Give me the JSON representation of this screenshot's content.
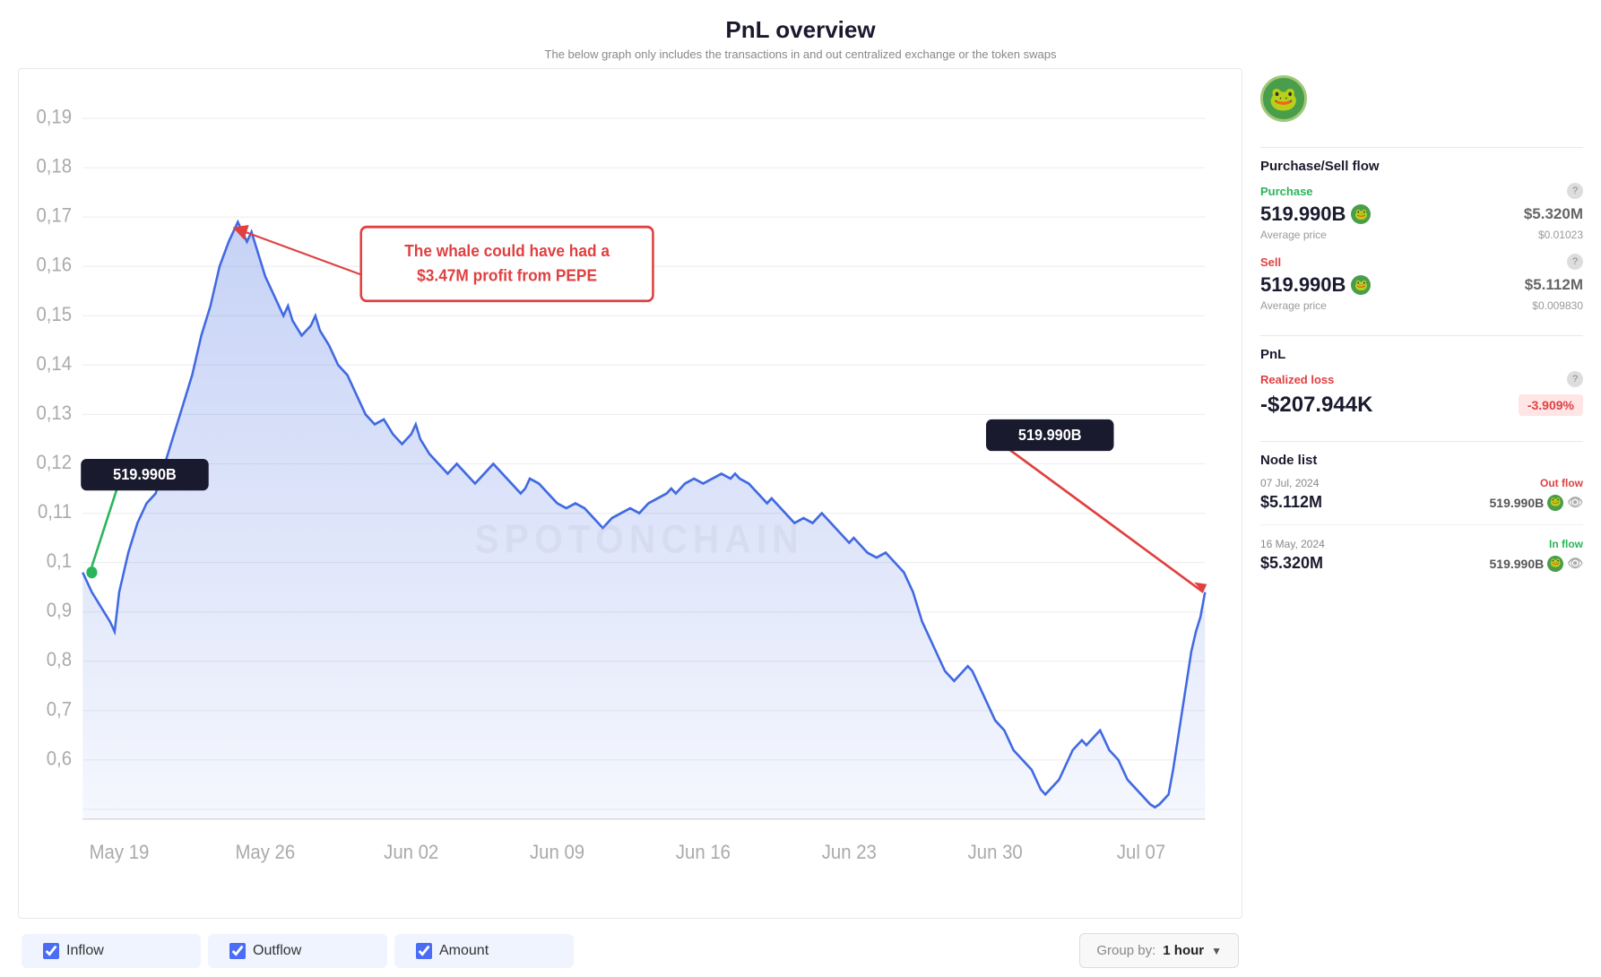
{
  "header": {
    "title": "PnL overview",
    "subtitle": "The below graph only includes the transactions in and out centralized exchange or the token swaps"
  },
  "chart": {
    "watermark": "SPOTONCHAIN",
    "annotation_text": "The whale could have had a\n$3.47M profit from PEPE",
    "tooltip_left": "519.990B",
    "tooltip_right": "519.990B",
    "y_axis_labels": [
      "0,19",
      "0,18",
      "0,17",
      "0,16",
      "0,15",
      "0,14",
      "0,13",
      "0,12",
      "0,11",
      "0,1",
      "0,9",
      "0,8",
      "0,7",
      "0,6"
    ],
    "x_axis_labels": [
      "May 19",
      "May 26",
      "Jun 02",
      "Jun 09",
      "Jun 16",
      "Jun 23",
      "Jun 30",
      "Jul 07"
    ]
  },
  "controls": {
    "inflow_label": "Inflow",
    "outflow_label": "Outflow",
    "amount_label": "Amount",
    "group_by_prefix": "Group by: ",
    "group_by_value": "1 hour"
  },
  "sidebar": {
    "section_purchase_sell": "Purchase/Sell flow",
    "purchase_label": "Purchase",
    "purchase_amount": "519.990B",
    "purchase_usd": "$5.320M",
    "purchase_avg_label": "Average price",
    "purchase_avg_value": "$0.01023",
    "sell_label": "Sell",
    "sell_amount": "519.990B",
    "sell_usd": "$5.112M",
    "sell_avg_label": "Average price",
    "sell_avg_value": "$0.009830",
    "section_pnl": "PnL",
    "realized_label": "Realized loss",
    "pnl_amount": "-$207.944K",
    "pnl_pct": "-3.909%",
    "section_node_list": "Node list",
    "node1_date": "07 Jul, 2024",
    "node1_flow": "Out flow",
    "node1_usd": "$5.112M",
    "node1_token": "519.990B",
    "node2_date": "16 May, 2024",
    "node2_flow": "In flow",
    "node2_usd": "$5.320M",
    "node2_token": "519.990B"
  }
}
